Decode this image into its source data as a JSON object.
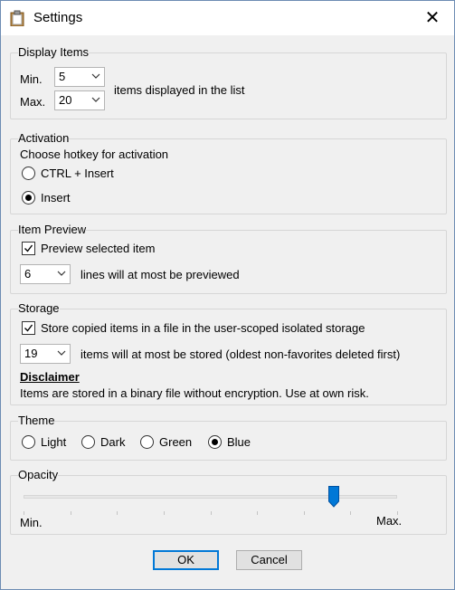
{
  "window": {
    "title": "Settings",
    "close_glyph": "✕",
    "icon": "clipboard-icon"
  },
  "display_items": {
    "legend": "Display Items",
    "min_label": "Min.",
    "min_value": "5",
    "max_label": "Max.",
    "max_value": "20",
    "suffix": "items displayed in the list"
  },
  "activation": {
    "legend": "Activation",
    "prompt": "Choose hotkey for activation",
    "options": [
      "CTRL + Insert",
      "Insert"
    ],
    "selected": "Insert"
  },
  "item_preview": {
    "legend": "Item Preview",
    "checkbox_label": "Preview selected item",
    "checked": true,
    "lines_value": "6",
    "lines_suffix": "lines will at most be previewed"
  },
  "storage": {
    "legend": "Storage",
    "checkbox_label": "Store copied items in a file in the user-scoped isolated storage",
    "checked": true,
    "count_value": "19",
    "count_suffix": "items will at most be stored (oldest non-favorites deleted first)",
    "disclaimer_title": "Disclaimer",
    "disclaimer_text": "Items are stored in a binary file without encryption. Use at own risk."
  },
  "theme": {
    "legend": "Theme",
    "options": [
      "Light",
      "Dark",
      "Green",
      "Blue"
    ],
    "selected": "Blue"
  },
  "opacity": {
    "legend": "Opacity",
    "min_label": "Min.",
    "max_label": "Max.",
    "value_fraction": 0.83,
    "tick_count": 9
  },
  "buttons": {
    "ok": "OK",
    "cancel": "Cancel"
  },
  "colors": {
    "accent": "#0078d7",
    "window_bg": "#f0f0f0",
    "border": "#6d8cb3"
  }
}
